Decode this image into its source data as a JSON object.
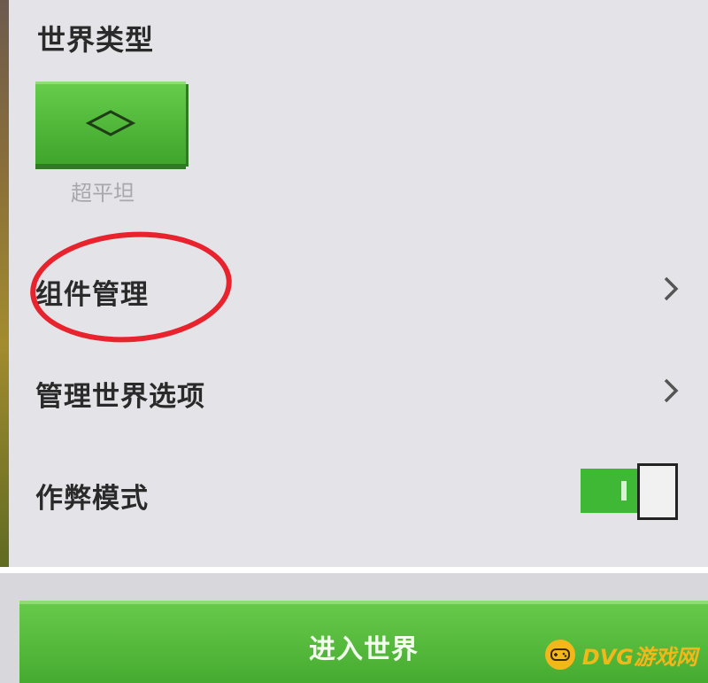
{
  "world_settings": {
    "section_title": "世界类型",
    "world_type": {
      "selected_label": "超平坦",
      "icon": "diamond-outline-icon"
    }
  },
  "menu": {
    "items": [
      {
        "label": "组件管理",
        "icon": "chevron-right-icon"
      },
      {
        "label": "管理世界选项",
        "icon": "chevron-right-icon"
      }
    ]
  },
  "cheats": {
    "label": "作弊模式",
    "enabled": true
  },
  "footer": {
    "enter_world_label": "进入世界"
  },
  "watermark": {
    "text": "DVG游戏网"
  },
  "colors": {
    "accent_green": "#4fb838",
    "annotation_red": "#e8232d",
    "watermark_yellow": "#f3b71a"
  }
}
